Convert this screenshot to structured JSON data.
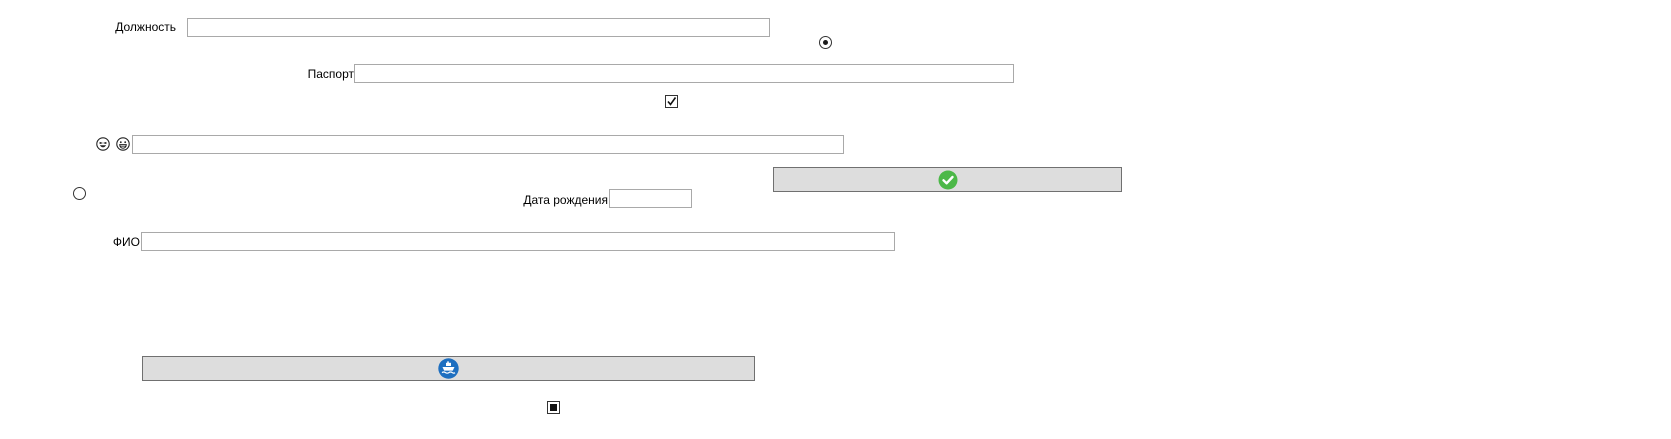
{
  "form": {
    "position_label": "Должность",
    "position_value": "",
    "passport_label": "Паспорт",
    "passport_value": "",
    "emoji_field_value": "",
    "birthdate_label": "Дата рождения",
    "birthdate_value": "",
    "fio_label": "ФИО",
    "fio_value": ""
  },
  "controls": {
    "radio_top_selected": true,
    "radio_left_selected": false,
    "checkbox_checked": true,
    "checkbox_indeterminate": true
  },
  "buttons": {
    "confirm_icon": "check-circle-icon",
    "confirm_color": "#4cb848",
    "ship_icon": "ship-icon",
    "ship_color": "#1e6fc0"
  },
  "icons": {
    "emoji_1": "laughing-face-icon",
    "emoji_2": "grinning-face-icon"
  }
}
